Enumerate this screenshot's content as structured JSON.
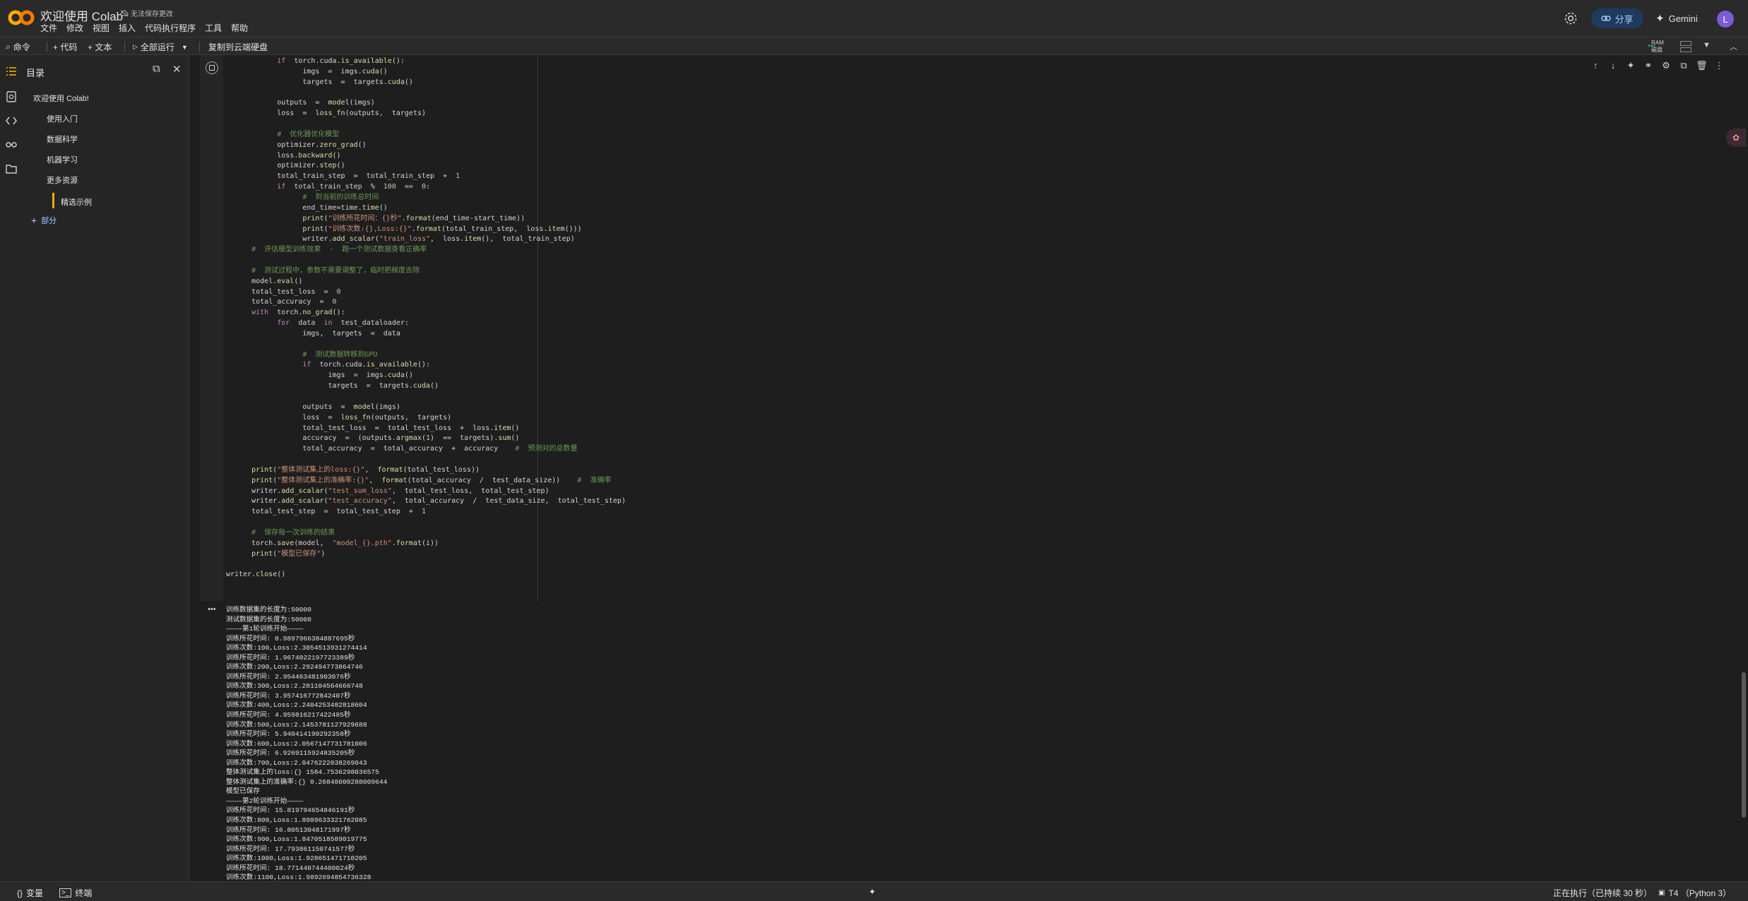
{
  "app": {
    "doc_title": "欢迎使用 Colab",
    "save_state": "无法保存更改",
    "menus": [
      "文件",
      "修改",
      "视图",
      "插入",
      "代码执行程序",
      "工具",
      "帮助"
    ],
    "share_label": "分享",
    "gemini_label": "Gemini",
    "avatar_initial": "L"
  },
  "toolbar": {
    "command": "命令",
    "add_code": "+ 代码",
    "add_text": "+ 文本",
    "run_all": "全部运行",
    "copy_drive": "复制到云端硬盘",
    "ram_label": "RAM",
    "disk_label": "磁盘"
  },
  "sidebar": {
    "title": "目录",
    "toc": [
      "欢迎使用 Colab!",
      "使用入门",
      "数据科学",
      "机器学习",
      "更多资源",
      "精选示例"
    ],
    "add_section": "部分"
  },
  "code_lines": [
    [
      {
        "t": "            "
      },
      {
        "t": "if",
        "c": "k"
      },
      {
        "t": "  torch.cuda."
      },
      {
        "t": "is_available",
        "c": "f"
      },
      {
        "t": "():"
      }
    ],
    [
      {
        "t": "                  imgs  =  imgs."
      },
      {
        "t": "cuda",
        "c": "f"
      },
      {
        "t": "()"
      }
    ],
    [
      {
        "t": "                  targets  =  targets."
      },
      {
        "t": "cuda",
        "c": "f"
      },
      {
        "t": "()"
      }
    ],
    [
      {
        "t": ""
      }
    ],
    [
      {
        "t": "            outputs  =  "
      },
      {
        "t": "model",
        "c": "f"
      },
      {
        "t": "(imgs)"
      }
    ],
    [
      {
        "t": "            loss  =  "
      },
      {
        "t": "loss_fn",
        "c": "f"
      },
      {
        "t": "(outputs,  targets)"
      }
    ],
    [
      {
        "t": ""
      }
    ],
    [
      {
        "t": "            #  优化器优化模型",
        "c": "c"
      }
    ],
    [
      {
        "t": "            optimizer."
      },
      {
        "t": "zero_grad",
        "c": "f"
      },
      {
        "t": "()"
      }
    ],
    [
      {
        "t": "            loss."
      },
      {
        "t": "backward",
        "c": "f"
      },
      {
        "t": "()"
      }
    ],
    [
      {
        "t": "            optimizer."
      },
      {
        "t": "step",
        "c": "f"
      },
      {
        "t": "()"
      }
    ],
    [
      {
        "t": "            total_train_step  =  total_train_step  +  "
      },
      {
        "t": "1",
        "c": "n"
      }
    ],
    [
      {
        "t": "            "
      },
      {
        "t": "if",
        "c": "k"
      },
      {
        "t": "  total_train_step  %  "
      },
      {
        "t": "100",
        "c": "n"
      },
      {
        "t": "  ==  "
      },
      {
        "t": "0",
        "c": "n"
      },
      {
        "t": ":"
      }
    ],
    [
      {
        "t": "                  #  到当前的训练总时间",
        "c": "c"
      }
    ],
    [
      {
        "t": "                  end_time=time."
      },
      {
        "t": "time",
        "c": "f"
      },
      {
        "t": "()"
      }
    ],
    [
      {
        "t": "                  "
      },
      {
        "t": "print",
        "c": "f"
      },
      {
        "t": "("
      },
      {
        "t": "\"训练所花时间：{}秒\"",
        "c": "s"
      },
      {
        "t": "."
      },
      {
        "t": "format",
        "c": "f"
      },
      {
        "t": "(end_time-start_time))"
      }
    ],
    [
      {
        "t": "                  "
      },
      {
        "t": "print",
        "c": "f"
      },
      {
        "t": "("
      },
      {
        "t": "\"训练次数:{},Loss:{}\"",
        "c": "s"
      },
      {
        "t": "."
      },
      {
        "t": "format",
        "c": "f"
      },
      {
        "t": "(total_train_step,  loss."
      },
      {
        "t": "item",
        "c": "f"
      },
      {
        "t": "()))"
      }
    ],
    [
      {
        "t": "                  writer."
      },
      {
        "t": "add_scalar",
        "c": "f"
      },
      {
        "t": "("
      },
      {
        "t": "\"train_loss\"",
        "c": "s"
      },
      {
        "t": ",  loss."
      },
      {
        "t": "item",
        "c": "f"
      },
      {
        "t": "(),  total_train_step)"
      }
    ],
    [
      {
        "t": "      #  评估模型训练效果  -  跑一个测试数据查看正确率",
        "c": "c"
      }
    ],
    [
      {
        "t": ""
      }
    ],
    [
      {
        "t": "      #  测试过程中，参数不需要调整了，临时把梯度去除",
        "c": "c"
      }
    ],
    [
      {
        "t": "      model."
      },
      {
        "t": "eval",
        "c": "f"
      },
      {
        "t": "()"
      }
    ],
    [
      {
        "t": "      total_test_loss  =  "
      },
      {
        "t": "0",
        "c": "n"
      }
    ],
    [
      {
        "t": "      total_accuracy  =  "
      },
      {
        "t": "0",
        "c": "n"
      }
    ],
    [
      {
        "t": "      "
      },
      {
        "t": "with",
        "c": "k"
      },
      {
        "t": "  torch."
      },
      {
        "t": "no_grad",
        "c": "f"
      },
      {
        "t": "():"
      }
    ],
    [
      {
        "t": "            "
      },
      {
        "t": "for",
        "c": "k"
      },
      {
        "t": "  data  "
      },
      {
        "t": "in",
        "c": "k"
      },
      {
        "t": "  test_dataloader:"
      }
    ],
    [
      {
        "t": "                  imgs,  targets  =  data"
      }
    ],
    [
      {
        "t": ""
      }
    ],
    [
      {
        "t": "                  #  测试数据转移到GPU",
        "c": "c"
      }
    ],
    [
      {
        "t": "                  "
      },
      {
        "t": "if",
        "c": "k"
      },
      {
        "t": "  torch.cuda."
      },
      {
        "t": "is_available",
        "c": "f"
      },
      {
        "t": "():"
      }
    ],
    [
      {
        "t": "                        imgs  =  imgs."
      },
      {
        "t": "cuda",
        "c": "f"
      },
      {
        "t": "()"
      }
    ],
    [
      {
        "t": "                        targets  =  targets."
      },
      {
        "t": "cuda",
        "c": "f"
      },
      {
        "t": "()"
      }
    ],
    [
      {
        "t": ""
      }
    ],
    [
      {
        "t": "                  outputs  =  "
      },
      {
        "t": "model",
        "c": "f"
      },
      {
        "t": "(imgs)"
      }
    ],
    [
      {
        "t": "                  loss  =  "
      },
      {
        "t": "loss_fn",
        "c": "f"
      },
      {
        "t": "(outputs,  targets)"
      }
    ],
    [
      {
        "t": "                  total_test_loss  =  total_test_loss  +  loss."
      },
      {
        "t": "item",
        "c": "f"
      },
      {
        "t": "()"
      }
    ],
    [
      {
        "t": "                  accuracy  =  (outputs."
      },
      {
        "t": "argmax",
        "c": "f"
      },
      {
        "t": "("
      },
      {
        "t": "1",
        "c": "n"
      },
      {
        "t": ")  ==  targets)."
      },
      {
        "t": "sum",
        "c": "f"
      },
      {
        "t": "()"
      }
    ],
    [
      {
        "t": "                  total_accuracy  =  total_accuracy  +  accuracy    "
      },
      {
        "t": "#  预测对的总数量",
        "c": "c"
      }
    ],
    [
      {
        "t": ""
      }
    ],
    [
      {
        "t": "      "
      },
      {
        "t": "print",
        "c": "f"
      },
      {
        "t": "("
      },
      {
        "t": "\"整体测试集上的loss:{}\"",
        "c": "s"
      },
      {
        "t": ",  "
      },
      {
        "t": "format",
        "c": "f"
      },
      {
        "t": "(total_test_loss))"
      }
    ],
    [
      {
        "t": "      "
      },
      {
        "t": "print",
        "c": "f"
      },
      {
        "t": "("
      },
      {
        "t": "\"整体测试集上的准确率:{}\"",
        "c": "s"
      },
      {
        "t": ",  "
      },
      {
        "t": "format",
        "c": "f"
      },
      {
        "t": "(total_accuracy  /  test_data_size))    "
      },
      {
        "t": "#  准确率",
        "c": "c"
      }
    ],
    [
      {
        "t": "      writer."
      },
      {
        "t": "add_scalar",
        "c": "f"
      },
      {
        "t": "("
      },
      {
        "t": "\"test_sum_loss\"",
        "c": "s"
      },
      {
        "t": ",  total_test_loss,  total_test_step)"
      }
    ],
    [
      {
        "t": "      writer."
      },
      {
        "t": "add_scalar",
        "c": "f"
      },
      {
        "t": "("
      },
      {
        "t": "\"test_accuracy\"",
        "c": "s"
      },
      {
        "t": ",  total_accuracy  /  test_data_size,  total_test_step)"
      }
    ],
    [
      {
        "t": "      total_test_step  =  total_test_step  +  "
      },
      {
        "t": "1",
        "c": "n"
      }
    ],
    [
      {
        "t": ""
      }
    ],
    [
      {
        "t": "      #  保存每一次训练的结果",
        "c": "c"
      }
    ],
    [
      {
        "t": "      torch."
      },
      {
        "t": "save",
        "c": "f"
      },
      {
        "t": "(model,  "
      },
      {
        "t": "\"model_{}.pth\"",
        "c": "s"
      },
      {
        "t": "."
      },
      {
        "t": "format",
        "c": "f"
      },
      {
        "t": "(i))"
      }
    ],
    [
      {
        "t": "      "
      },
      {
        "t": "print",
        "c": "f"
      },
      {
        "t": "("
      },
      {
        "t": "\"模型已保存\"",
        "c": "s"
      },
      {
        "t": ")"
      }
    ],
    [
      {
        "t": ""
      }
    ],
    [
      {
        "t": "writer."
      },
      {
        "t": "close",
        "c": "f"
      },
      {
        "t": "()"
      }
    ]
  ],
  "output_lines": [
    "训练数据集的长度为:50000",
    "测试数据集的长度为:50000",
    "————第1轮训练开始————",
    "训练所花时间: 0.9897966384887695秒",
    "训练次数:100,Loss:2.3054513931274414",
    "训练所花时间: 1.9674022197723389秒",
    "训练次数:200,Loss:2.292494773864746",
    "训练所花时间: 2.954463481903076秒",
    "训练次数:300,Loss:2.281104564666748",
    "训练所花时间: 3.957416772842407秒",
    "训练次数:400,Loss:2.2404253482818604",
    "训练所花时间: 4.959816217422485秒",
    "训练次数:500,Loss:2.1453781127929688",
    "训练所花时间: 5.940414190292358秒",
    "训练次数:600,Loss:2.0567147731781006",
    "训练所花时间: 6.9269115924835205秒",
    "训练次数:700,Loss:2.0476222038269043",
    "整体测试集上的loss:{} 1584.7536298036575",
    "整体测试集上的准确率:{} 0.26848000288009644",
    "模型已保存",
    "————第2轮训练开始————",
    "训练所花时间: 15.819794654846191秒",
    "训练次数:800,Loss:1.8989633321762085",
    "训练所花时间: 16.8051304817199​7秒",
    "训练次数:900,Loss:1.8470518589019775",
    "训练所花时间: 17.793861150741577秒",
    "训练次数:1000,Loss:1.928651471710205",
    "训练所花时间: 18.771440744400024秒",
    "训练次数:1100,Loss:1.9892694854736328"
  ],
  "status": {
    "variables": "变量",
    "terminal": "终端",
    "running": "正在执行（已持续 30 秒）",
    "runtime": "T4 （Python 3）"
  }
}
